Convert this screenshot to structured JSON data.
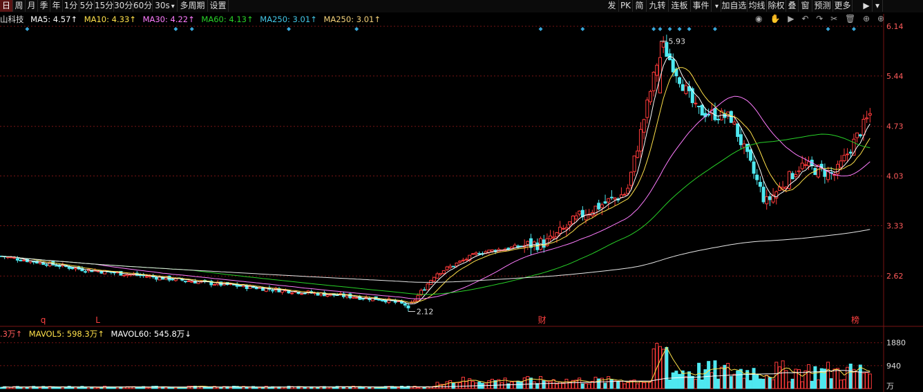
{
  "toolbar": {
    "left": [
      "日",
      "周",
      "月",
      "季",
      "年",
      "1分",
      "5分",
      "15分",
      "30分",
      "60分",
      "30s",
      "多周期",
      "设置"
    ],
    "right": [
      "发",
      "PK",
      "简",
      "九转",
      "连板",
      "事件",
      "加自选",
      "均线",
      "除权",
      "叠",
      "窗",
      "预测",
      "更多"
    ]
  },
  "stock_name_fragment": "山科技",
  "ma": {
    "ma5": "MA5: 4.57↑",
    "ma10": "MA10: 4.33↑",
    "ma30": "MA30: 4.22↑",
    "ma60": "MA60: 4.13↑",
    "ma250a": "MA250: 3.01↑",
    "ma250b": "MA250: 3.01↑"
  },
  "tools": [
    "eye-icon",
    "hand-icon",
    "play-icon",
    "undo-icon",
    "redo-icon",
    "scissors-icon",
    "trash-icon",
    "add-icon",
    "add-icon"
  ],
  "price_axis": [
    "6.14",
    "5.44",
    "4.73",
    "4.03",
    "3.33",
    "2.62"
  ],
  "annotations": {
    "high": "5.93",
    "low": "2.12"
  },
  "markers": {
    "q": "q",
    "L": "L",
    "cai": "财",
    "bang": "榜"
  },
  "volume_legend": {
    "vol": ".3万↑",
    "mavol5": "MAVOL5: 598.3万↑",
    "mavol60": "MAVOL60: 545.8万↓"
  },
  "volume_axis": [
    "1880",
    "940"
  ],
  "volume_unit": "万",
  "colors": {
    "up": "#ff3b3b",
    "down": "#4fe8f0",
    "ma5": "#ffffff",
    "ma10": "#ffe14a",
    "ma30": "#ff7cff",
    "ma60": "#28d228",
    "ma250": "#e8e8e8",
    "grid": "#7a1414"
  },
  "chart_data": {
    "type": "candlestick",
    "ylim": [
      2.12,
      6.14
    ],
    "high": 5.93,
    "low": 2.12,
    "segments": [
      {
        "from": 0,
        "to": 2.9
      },
      {
        "from": 0.09,
        "to": 2.72
      },
      {
        "from": 0.24,
        "to": 2.52
      },
      {
        "from": 0.34,
        "to": 2.4
      },
      {
        "from": 0.44,
        "to": 2.29
      },
      {
        "from": 0.47,
        "to": 2.2
      },
      {
        "from": 0.5,
        "to": 2.65
      },
      {
        "from": 0.55,
        "to": 2.95
      },
      {
        "from": 0.63,
        "to": 3.1
      },
      {
        "from": 0.67,
        "to": 3.5
      },
      {
        "from": 0.72,
        "to": 3.8
      },
      {
        "from": 0.76,
        "to": 5.9
      },
      {
        "from": 0.8,
        "to": 4.95
      },
      {
        "from": 0.84,
        "to": 4.85
      },
      {
        "from": 0.88,
        "to": 3.65
      },
      {
        "from": 0.92,
        "to": 4.18
      },
      {
        "from": 0.96,
        "to": 4.05
      },
      {
        "from": 1.0,
        "to": 4.9
      }
    ],
    "diamond_markers": 16
  }
}
